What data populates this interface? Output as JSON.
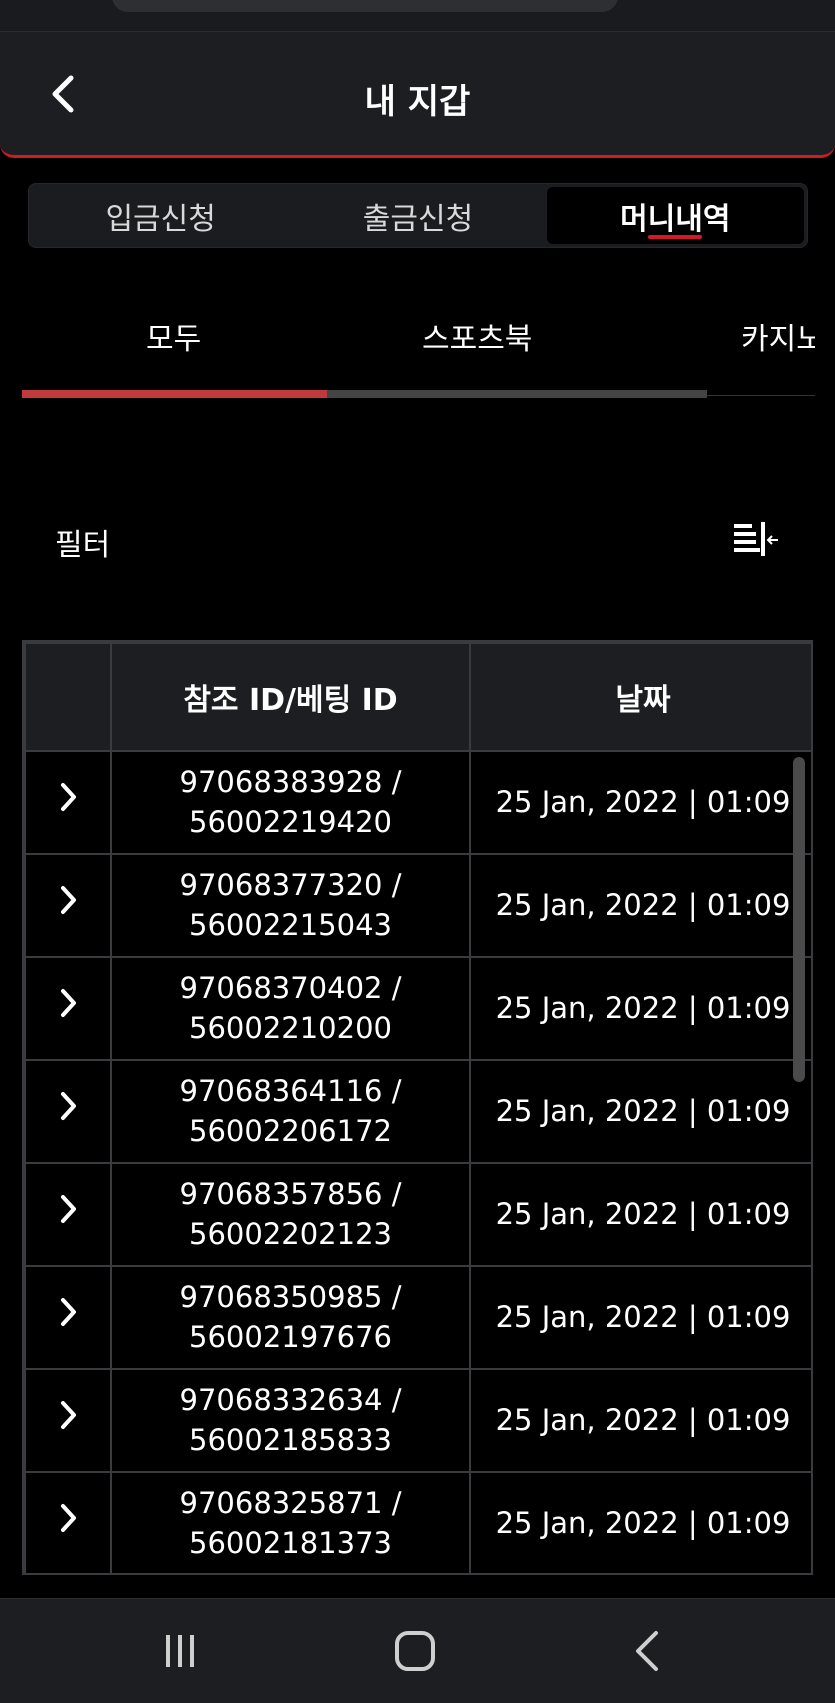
{
  "header": {
    "title": "내 지갑"
  },
  "segments": [
    "입금신청",
    "출금신청",
    "머니내역"
  ],
  "active_segment": 2,
  "subtabs": [
    "모두",
    "스포츠북",
    "카지노"
  ],
  "active_subtab": 0,
  "subtab_progress": 0.445,
  "filter": {
    "label": "필터"
  },
  "table": {
    "headers": [
      "",
      "참조 ID/베팅 ID",
      "날짜"
    ],
    "rows": [
      {
        "ref": "97068383928 /",
        "bet": "56002219420",
        "date": "25 Jan, 2022 | 01:09"
      },
      {
        "ref": "97068377320 /",
        "bet": "56002215043",
        "date": "25 Jan, 2022 | 01:09"
      },
      {
        "ref": "97068370402 /",
        "bet": "56002210200",
        "date": "25 Jan, 2022 | 01:09"
      },
      {
        "ref": "97068364116 /",
        "bet": "56002206172",
        "date": "25 Jan, 2022 | 01:09"
      },
      {
        "ref": "97068357856 /",
        "bet": "56002202123",
        "date": "25 Jan, 2022 | 01:09"
      },
      {
        "ref": "97068350985 /",
        "bet": "56002197676",
        "date": "25 Jan, 2022 | 01:09"
      },
      {
        "ref": "97068332634 /",
        "bet": "56002185833",
        "date": "25 Jan, 2022 | 01:09"
      },
      {
        "ref": "97068325871 /",
        "bet": "56002181373",
        "date": "25 Jan, 2022 | 01:09"
      }
    ]
  },
  "colors": {
    "accent": "#d21a26",
    "background": "#000000",
    "panel": "#1d1e22",
    "progress": "#c2393d"
  },
  "icons": {
    "back": "chevron-left-icon",
    "filter": "filter-icon",
    "row": "chevron-right-icon"
  }
}
